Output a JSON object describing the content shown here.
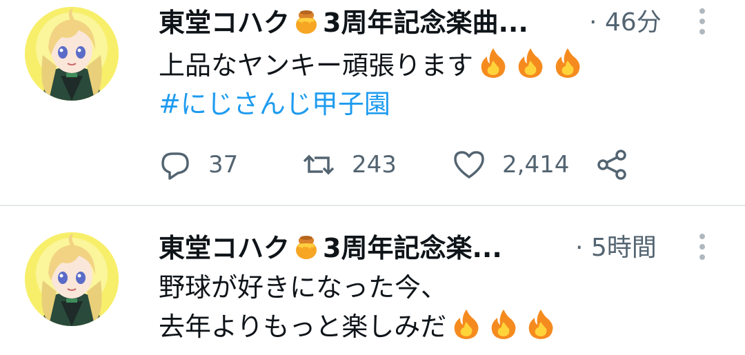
{
  "tweets": [
    {
      "author": "東堂コハク",
      "author_suffix": "3周年記念楽曲...",
      "time": "· 46分",
      "lines": [
        "上品なヤンキー頑張ります"
      ],
      "hashtag": "#にじさんじ甲子園",
      "stats": {
        "replies": "37",
        "retweets": "243",
        "likes": "2,414"
      }
    },
    {
      "author": "東堂コハク",
      "author_suffix": "3周年記念楽...",
      "time": "· 5時間",
      "lines": [
        "野球が好きになった今、",
        "去年よりもっと楽しみだ"
      ]
    }
  ],
  "icons": {
    "honey": "honey-pot-icon",
    "fire": "fire-icon",
    "reply": "reply-icon",
    "retweet": "retweet-icon",
    "like": "heart-icon",
    "share": "share-icon",
    "more": "more-vertical-icon"
  },
  "colors": {
    "hashtag": "#1d9bf0",
    "secondary_text": "#536471",
    "divider": "#e3e7ea"
  }
}
